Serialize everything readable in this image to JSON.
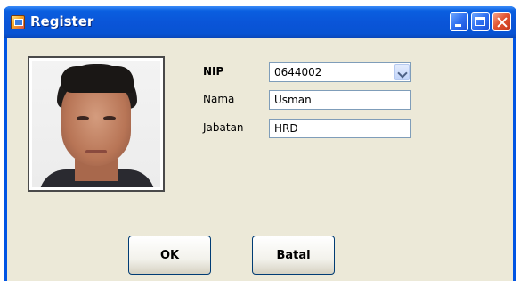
{
  "window": {
    "title": "Register"
  },
  "icons": {
    "app": "register-app-icon",
    "minimize": "minimize-icon",
    "maximize": "maximize-icon",
    "close": "close-icon",
    "dropdown": "chevron-down-icon"
  },
  "form": {
    "nip_label": "NIP",
    "nip_value": "0644002",
    "nama_label": "Nama",
    "nama_value": "Usman",
    "jabatan_label": "Jabatan",
    "jabatan_value": "HRD"
  },
  "buttons": {
    "ok_label": "OK",
    "cancel_label": "Batal"
  },
  "colors": {
    "titlebar": "#0a55d8",
    "client_bg": "#ece9d8",
    "close_button": "#e25431"
  }
}
